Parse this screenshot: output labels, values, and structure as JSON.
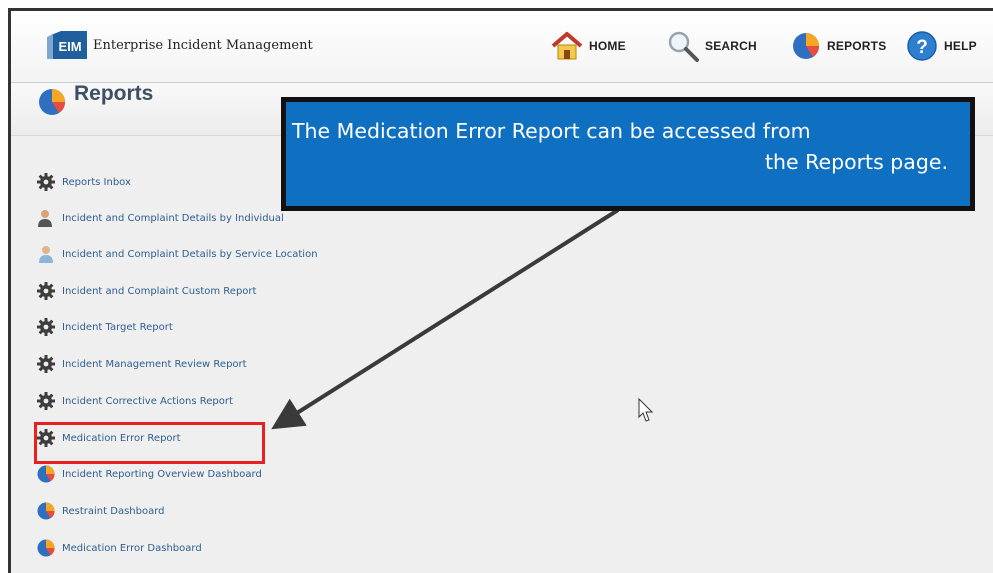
{
  "app": {
    "logo_text": "EIM",
    "title": "Enterprise Incident Management"
  },
  "nav": {
    "home": {
      "label": "HOME",
      "icon": "home-icon"
    },
    "search": {
      "label": "SEARCH",
      "icon": "search-icon"
    },
    "reports": {
      "label": "REPORTS",
      "icon": "pie-chart-icon"
    },
    "help": {
      "label": "HELP",
      "icon": "help-icon"
    }
  },
  "page": {
    "title": "Reports"
  },
  "reports": [
    {
      "label": "Reports Inbox",
      "icon": "gear-icon"
    },
    {
      "label": "Incident and Complaint Details by Individual",
      "icon": "person-icon"
    },
    {
      "label": "Incident and Complaint Details by Service Location",
      "icon": "location-person-icon"
    },
    {
      "label": "Incident and Complaint Custom Report",
      "icon": "gear-icon"
    },
    {
      "label": "Incident Target Report",
      "icon": "gear-icon"
    },
    {
      "label": "Incident Management Review Report",
      "icon": "gear-icon"
    },
    {
      "label": "Incident Corrective Actions Report",
      "icon": "gear-icon"
    },
    {
      "label": "Medication Error Report",
      "icon": "gear-icon"
    },
    {
      "label": "Incident Reporting Overview Dashboard",
      "icon": "pie-chart-icon"
    },
    {
      "label": "Restraint Dashboard",
      "icon": "pie-chart-icon"
    },
    {
      "label": "Medication Error Dashboard",
      "icon": "pie-chart-icon"
    }
  ],
  "callout": {
    "line1": "The Medication Error Report can be accessed from",
    "line2": "the Reports page."
  },
  "colors": {
    "callout_bg": "#0f6fc1",
    "highlight": "#e8201f",
    "link": "#2e5f8f",
    "logo": "#1f5f9e"
  }
}
